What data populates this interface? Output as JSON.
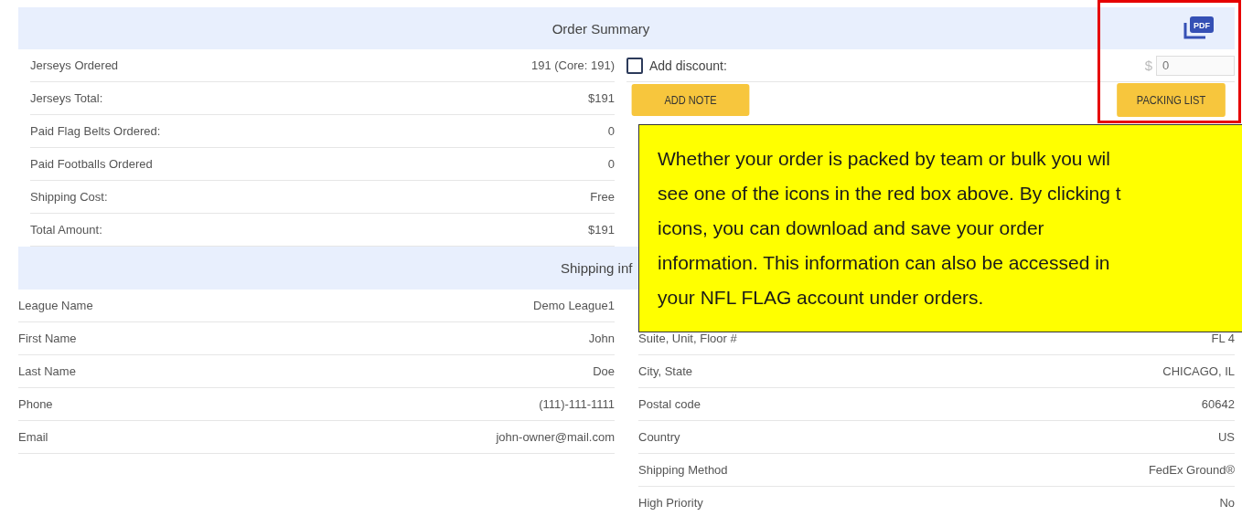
{
  "summary": {
    "title": "Order Summary",
    "rows": [
      {
        "label": "Jerseys Ordered",
        "value": "191 (Core: 191)"
      },
      {
        "label": "Jerseys Total:",
        "value": "$191"
      },
      {
        "label": "Paid Flag Belts Ordered:",
        "value": "0"
      },
      {
        "label": "Paid Footballs Ordered",
        "value": "0"
      },
      {
        "label": "Shipping Cost:",
        "value": "Free"
      },
      {
        "label": "Total Amount:",
        "value": "$191"
      }
    ],
    "discount": {
      "label": "Add discount:",
      "checked": false,
      "currency": "$",
      "placeholder": "0"
    },
    "pdf_label": "PDF",
    "add_note": "ADD NOTE",
    "packing_list": "PACKING LIST"
  },
  "shipping": {
    "title": "Shipping inf",
    "left": [
      {
        "label": "League Name",
        "value": "Demo League1"
      },
      {
        "label": "First Name",
        "value": "John"
      },
      {
        "label": "Last Name",
        "value": "Doe"
      },
      {
        "label": "Phone",
        "value": "(111)-111-1111"
      },
      {
        "label": "Email",
        "value": "john-owner@mail.com"
      }
    ],
    "right": [
      {
        "label": "Suite, Unit, Floor #",
        "value": "FL 4"
      },
      {
        "label": "City, State",
        "value": "CHICAGO, IL"
      },
      {
        "label": "Postal code",
        "value": "60642"
      },
      {
        "label": "Country",
        "value": "US"
      },
      {
        "label": "Shipping Method",
        "value": "FedEx Ground®"
      },
      {
        "label": "High Priority",
        "value": "No"
      }
    ]
  },
  "callout": {
    "lines": [
      "Whether your order is packed by team or bulk you wil",
      "see one of the icons in the red box above. By clicking t",
      "icons, you can download and save your order",
      "information. This information can also be accessed in",
      "your NFL FLAG account under orders."
    ]
  }
}
